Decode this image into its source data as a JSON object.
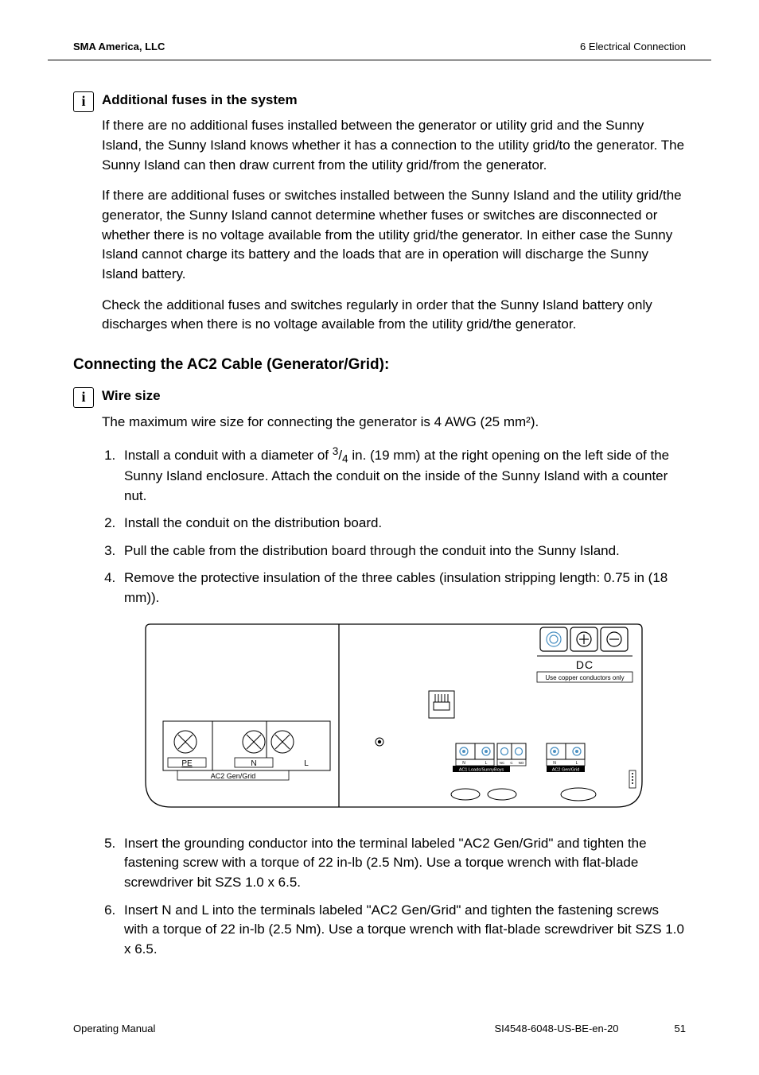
{
  "header": {
    "left": "SMA America, LLC",
    "right": "6  Electrical Connection"
  },
  "note1": {
    "heading": "Additional fuses in the system",
    "p1": "If there are no additional fuses installed between the generator or utility grid and the Sunny Island, the Sunny Island knows whether it has a connection to the utility grid/to the generator. The Sunny Island can then draw current from the utility grid/from the generator.",
    "p2": "If there are additional fuses or switches installed between the Sunny Island and the utility grid/the generator, the Sunny Island cannot determine whether fuses or switches are disconnected or whether there is no voltage available from the utility grid/the generator. In either case the Sunny Island cannot charge its battery and the loads that are in operation will discharge the Sunny Island battery.",
    "p3": "Check the additional fuses and switches regularly in order that the Sunny Island battery only discharges when there is no voltage available from the utility grid/the generator."
  },
  "section_heading": "Connecting the AC2 Cable (Generator/Grid):",
  "note2": {
    "heading": "Wire size",
    "p1": "The maximum wire size for connecting the generator is 4 AWG (25 mm²)."
  },
  "steps": {
    "s1a": "Install a conduit with a diameter of ",
    "s1_frac_num": "3",
    "s1_frac_slash": "/",
    "s1_frac_den": "4",
    "s1b": " in. (19 mm) at the right opening on the left side of the Sunny Island enclosure. Attach the conduit on the inside of the Sunny Island with a counter nut.",
    "s2": "Install the conduit on the distribution board.",
    "s3": "Pull the cable from the distribution board through the conduit into the Sunny Island.",
    "s4": "Remove the protective insulation of the three cables (insulation stripping length: 0.75 in (18 mm)).",
    "s5": "Insert the grounding conductor into the terminal labeled \"AC2 Gen/Grid\" and tighten the fastening screw with a torque of 22 in-lb (2.5 Nm). Use a torque wrench with flat-blade screwdriver bit SZS 1.0 x 6.5.",
    "s6": "Insert N and L into the terminals labeled \"AC2 Gen/Grid\" and tighten the fastening screws with a torque of 22 in-lb (2.5 Nm). Use a torque wrench with flat-blade screwdriver bit SZS 1.0 x 6.5."
  },
  "diagram": {
    "pe": "PE",
    "n": "N",
    "l": "L",
    "ac2": "AC2 Gen/Grid",
    "dc": "DC",
    "copper": "Use copper conductors only",
    "ac1_lbl": "AC1 Loads/SunnyBoys",
    "ac2_lbl": "AC2 Gen/Grid",
    "tiny_n": "N",
    "tiny_l": "L",
    "tiny_nc": "NC",
    "tiny_c": "C",
    "tiny_no": "NO"
  },
  "footer": {
    "left": "Operating Manual",
    "doc": "SI4548-6048-US-BE-en-20",
    "page": "51"
  }
}
